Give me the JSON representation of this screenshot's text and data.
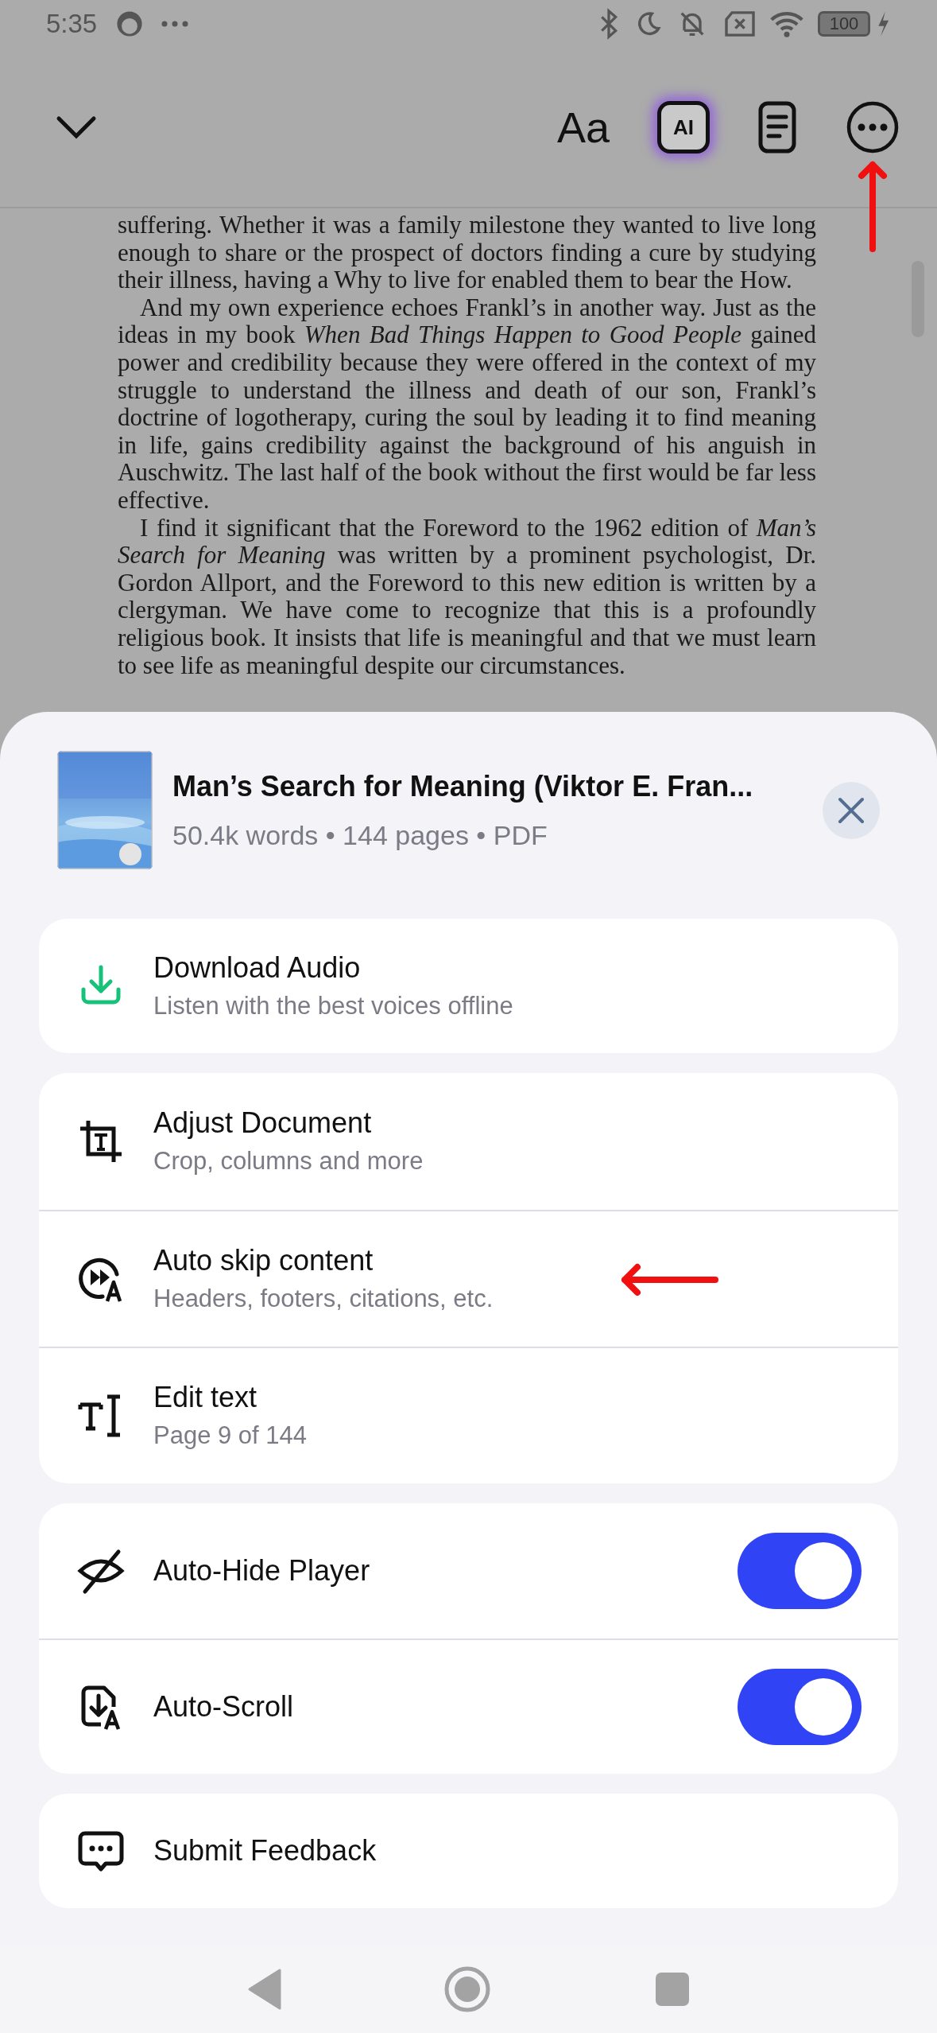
{
  "status_bar": {
    "time": "5:35",
    "battery": "100"
  },
  "toolbar": {
    "font_button": "Aa",
    "ai_button": "AI"
  },
  "document": {
    "paragraphs": [
      {
        "kind": "continuation",
        "text": "suffering. Whether it was a family milestone they wanted to live long enough to share or the prospect of doctors finding a cure by studying their illness, having a Why to live for enabled them to bear the How."
      },
      {
        "kind": "paragraph",
        "text": "And my own experience echoes Frankl’s in another way. Just as the ideas in my book *When Bad Things Happen to Good People* gained power and credibility because they were offered in the context of my struggle to understand the illness and death of our son, Frankl’s doctrine of logotherapy, curing the soul by leading it to find meaning in life, gains credibility against the background of his anguish in Auschwitz. The last half of the book without the first would be far less effective."
      },
      {
        "kind": "paragraph",
        "text": "I find it significant that the Foreword to the 1962 edition of *Man’s Search for Meaning* was written by a prominent psychologist, Dr. Gordon Allport, and the Foreword to this new edition is written by a clergyman. We have come to recognize that this is a profoundly religious book. It insists that life is meaningful and that we must learn to see life as meaningful despite our circumstances."
      }
    ]
  },
  "sheet": {
    "book": {
      "title": "Man’s Search for Meaning (Viktor E. Fran...",
      "meta": "50.4k words • 144 pages • PDF"
    },
    "groups": [
      {
        "items": [
          {
            "kind": "action",
            "title": "Download Audio",
            "subtitle": "Listen with the best voices offline"
          }
        ]
      },
      {
        "items": [
          {
            "kind": "action",
            "title": "Adjust Document",
            "subtitle": "Crop, columns and more"
          },
          {
            "kind": "action",
            "title": "Auto skip content",
            "subtitle": "Headers, footers, citations, etc."
          },
          {
            "kind": "action",
            "title": "Edit text",
            "subtitle": "Page 9 of 144"
          }
        ]
      },
      {
        "items": [
          {
            "kind": "toggle",
            "title": "Auto-Hide Player",
            "on": true
          },
          {
            "kind": "toggle",
            "title": "Auto-Scroll",
            "on": true
          }
        ]
      },
      {
        "items": [
          {
            "kind": "action",
            "title": "Submit Feedback"
          }
        ]
      }
    ]
  }
}
